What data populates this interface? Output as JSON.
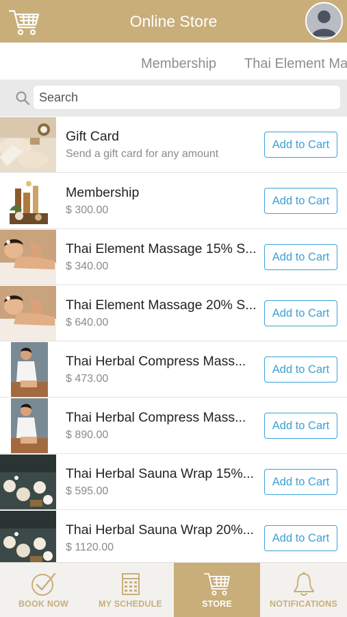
{
  "header": {
    "title": "Online Store"
  },
  "category_tabs": [
    "Membership",
    "Thai Element Ma"
  ],
  "search": {
    "placeholder": "Search",
    "value": ""
  },
  "products": [
    {
      "name": "Gift Card",
      "subtitle": "Send a gift card for any amount",
      "button": "Add to Cart",
      "image": "gift-card-spa-photo"
    },
    {
      "name": "Membership",
      "subtitle": "$ 300.00",
      "button": "Add to Cart",
      "image": "membership-spa-products-photo"
    },
    {
      "name": "Thai Element Massage 15% S...",
      "subtitle": "$ 340.00",
      "button": "Add to Cart",
      "image": "massage-photo"
    },
    {
      "name": "Thai Element Massage 20% S...",
      "subtitle": "$ 640.00",
      "button": "Add to Cart",
      "image": "massage-photo"
    },
    {
      "name": "Thai Herbal Compress Mass...",
      "subtitle": "$ 473.00",
      "button": "Add to Cart",
      "image": "herbal-compress-photo"
    },
    {
      "name": "Thai Herbal Compress Mass...",
      "subtitle": "$ 890.00",
      "button": "Add to Cart",
      "image": "herbal-compress-photo"
    },
    {
      "name": "Thai Herbal Sauna Wrap 15%...",
      "subtitle": "$ 595.00",
      "button": "Add to Cart",
      "image": "sauna-wrap-photo"
    },
    {
      "name": "Thai Herbal Sauna Wrap 20%...",
      "subtitle": "$ 1120.00",
      "button": "Add to Cart",
      "image": "sauna-wrap-photo"
    }
  ],
  "bottom_nav": [
    {
      "label": "BOOK NOW",
      "icon": "check-circle-icon",
      "active": false
    },
    {
      "label": "MY SCHEDULE",
      "icon": "calendar-icon",
      "active": false
    },
    {
      "label": "STORE",
      "icon": "cart-icon",
      "active": true
    },
    {
      "label": "NOTIFICATIONS",
      "icon": "bell-icon",
      "active": false
    }
  ],
  "colors": {
    "brand_gold": "#c9ae7a",
    "button_blue": "#3aa0d8",
    "search_bg": "#e9e9ea"
  }
}
